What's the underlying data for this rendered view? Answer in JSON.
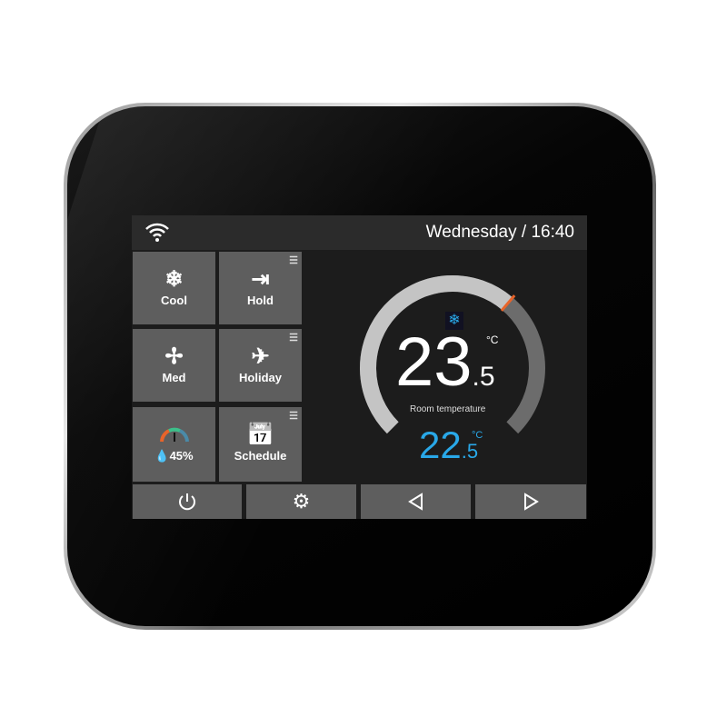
{
  "header": {
    "wifi_icon": "wifi-icon",
    "datetime": "Wednesday / 16:40"
  },
  "tiles": [
    {
      "label": "Cool",
      "icon": "snowflake-icon",
      "glyph": "❄"
    },
    {
      "label": "Hold",
      "icon": "enter-door-icon",
      "glyph": "⇥"
    },
    {
      "label": "Med",
      "icon": "fan-icon",
      "glyph": "✢"
    },
    {
      "label": "Holiday",
      "icon": "airplane-icon",
      "glyph": "✈"
    },
    {
      "label": "45%",
      "icon": "humidity-gauge-icon",
      "glyph": ""
    },
    {
      "label": "Schedule",
      "icon": "calendar-clock-icon",
      "glyph": "📅"
    }
  ],
  "thermostat": {
    "room_temp_int": "23",
    "room_temp_dec": ".5",
    "unit": "°C",
    "room_label": "Room temperature",
    "set_temp_int": "22",
    "set_temp_dec": ".5",
    "set_unit": "°C",
    "level_fraction": 0.65,
    "mode_icon": "snowflake-icon"
  },
  "colors": {
    "accent_blue": "#29a8e8",
    "marker_orange": "#e8642a",
    "tile": "#5e5e5e"
  },
  "bottom_buttons": [
    {
      "icon": "power-icon"
    },
    {
      "icon": "gear-icon"
    },
    {
      "icon": "left-triangle-icon"
    },
    {
      "icon": "right-triangle-icon"
    }
  ]
}
